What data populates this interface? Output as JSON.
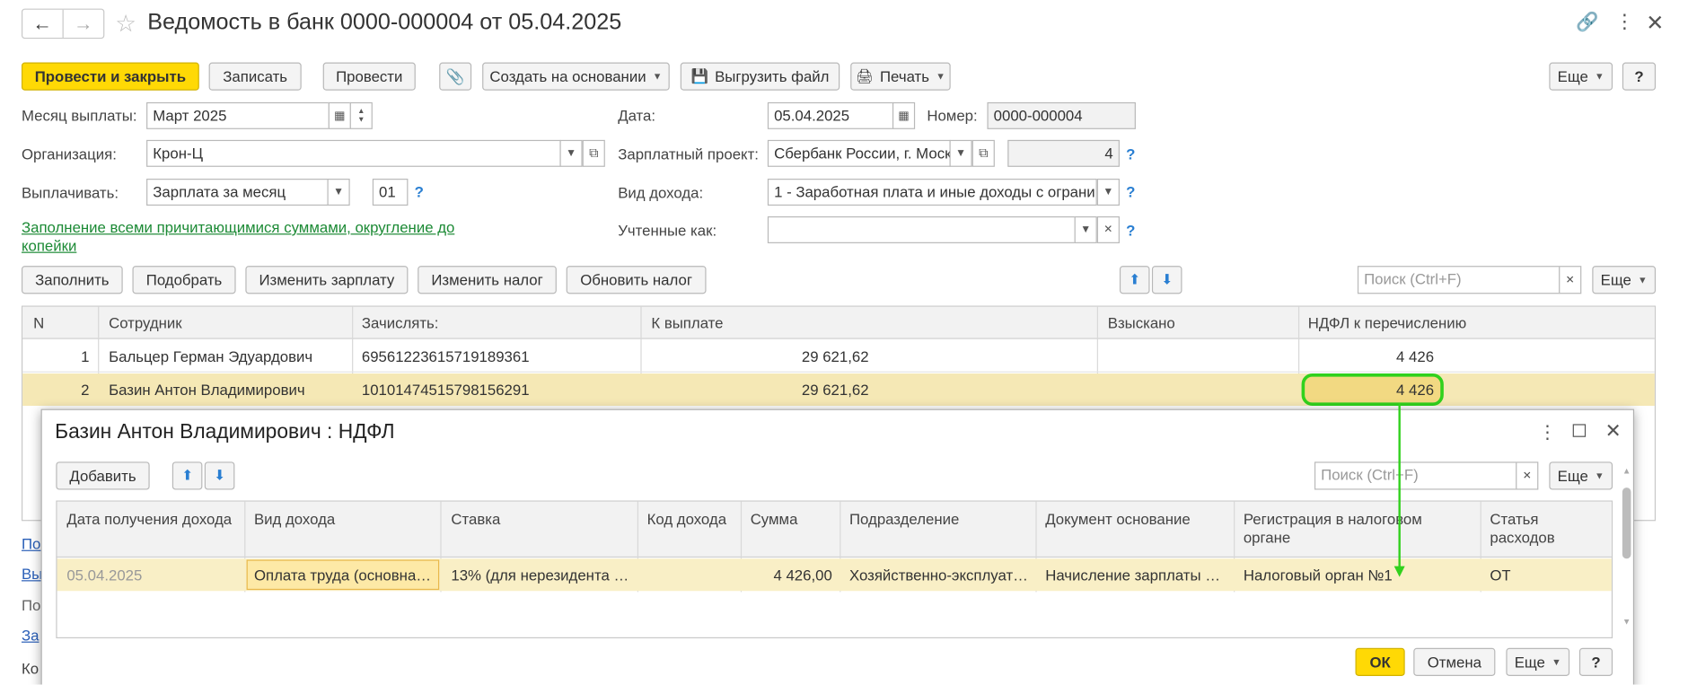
{
  "title": "Ведомость в банк 0000-000004 от 05.04.2025",
  "toolbar": {
    "post_close": "Провести и закрыть",
    "save": "Записать",
    "post": "Провести",
    "create_based": "Создать на основании",
    "export_file": "Выгрузить файл",
    "print": "Печать",
    "more": "Еще",
    "help": "?"
  },
  "form": {
    "month_label": "Месяц выплаты:",
    "month_value": "Март 2025",
    "org_label": "Организация:",
    "org_value": "Крон-Ц",
    "pay_label": "Выплачивать:",
    "pay_value": "Зарплата за месяц",
    "pay_code": "01",
    "fill_link": "Заполнение всеми причитающимися суммами, округление до копейки",
    "date_label": "Дата:",
    "date_value": "05.04.2025",
    "number_label": "Номер:",
    "number_value": "0000-000004",
    "project_label": "Зарплатный проект:",
    "project_value": "Сбербанк России, г. Моск",
    "project_num": "4",
    "income_label": "Вид дохода:",
    "income_value": "1 - Заработная плата и иные доходы с ограни",
    "accounted_label": "Учтенные как:",
    "accounted_value": ""
  },
  "table_toolbar": {
    "fill": "Заполнить",
    "select": "Подобрать",
    "change_salary": "Изменить зарплату",
    "change_tax": "Изменить налог",
    "update_tax": "Обновить налог",
    "search_placeholder": "Поиск (Ctrl+F)",
    "more": "Еще"
  },
  "table": {
    "columns": [
      "N",
      "Сотрудник",
      "Зачислять:",
      "К выплате",
      "Взыскано",
      "НДФЛ к перечислению"
    ],
    "rows": [
      {
        "n": "1",
        "employee": "Бальцер Герман Эдуардович",
        "account": "69561223615719189361",
        "pay": "29 621,62",
        "recovered": "",
        "ndfl": "4 426"
      },
      {
        "n": "2",
        "employee": "Базин Антон Владимирович",
        "account": "10101474515798156291",
        "pay": "29 621,62",
        "recovered": "",
        "ndfl": "4 426"
      }
    ]
  },
  "left_links": [
    "По",
    "Вы",
    "По",
    "За",
    "Ко"
  ],
  "dialog": {
    "title": "Базин Антон Владимирович : НДФЛ",
    "add": "Добавить",
    "search_placeholder": "Поиск (Ctrl+F)",
    "more": "Еще",
    "columns": [
      "Дата получения дохода",
      "Вид дохода",
      "Ставка",
      "Код дохода",
      "Сумма",
      "Подразделение",
      "Документ основание",
      "Регистрация в налоговом органе",
      "Статья расходов"
    ],
    "rows": [
      {
        "date": "05.04.2025",
        "kind": "Оплата труда (основна…",
        "rate": "13% (для нерезидента …",
        "code": "",
        "sum": "4 426,00",
        "dept": "Хозяйственно-эксплуат…",
        "doc": "Начисление зарплаты …",
        "reg": "Налоговый орган №1",
        "article": "ОТ"
      }
    ],
    "ok": "ОК",
    "cancel": "Отмена",
    "help": "?"
  },
  "colors": {
    "accent_yellow": "#ffd905",
    "highlight": "#31d11d",
    "selected_row": "#f5e8b5"
  }
}
